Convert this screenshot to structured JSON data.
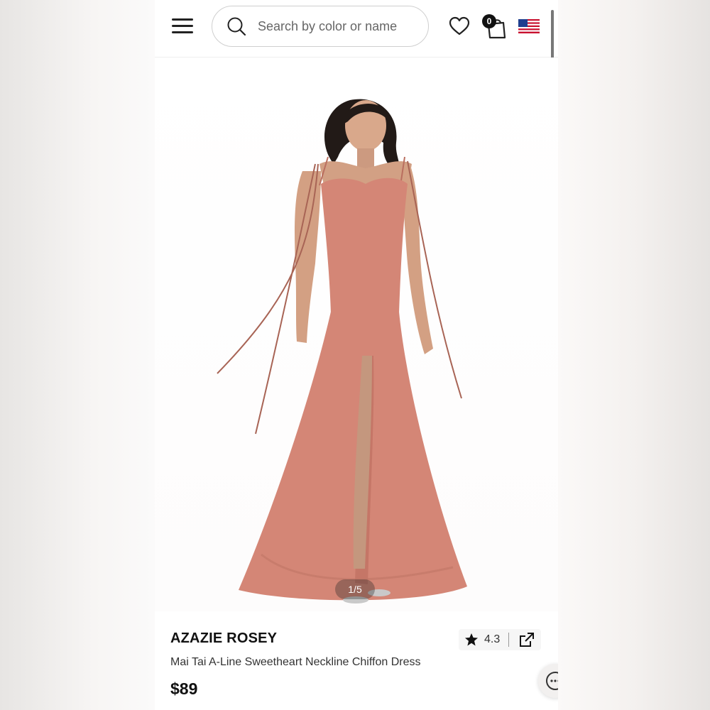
{
  "header": {
    "search_placeholder": "Search by color or name",
    "bag_count": "0"
  },
  "gallery": {
    "counter": "1/5",
    "dress_color": "#d48676"
  },
  "product": {
    "brand": "AZAZIE ROSEY",
    "name": "Mai Tai A-Line Sweetheart Neckline Chiffon Dress",
    "price": "$89",
    "rating": "4.3"
  }
}
